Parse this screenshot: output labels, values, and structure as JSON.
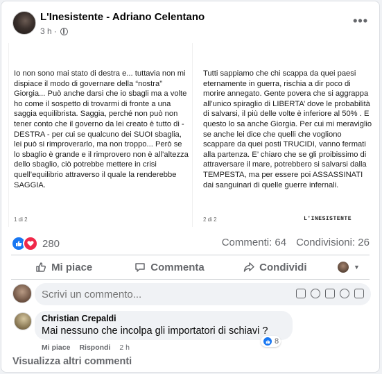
{
  "post": {
    "author": "L'Inesistente - Adriano Celentano",
    "time": "3 h",
    "privacy_icon": "globe-icon",
    "more_label": "•••"
  },
  "images": [
    {
      "text": "Io non sono mai stato di destra e... tuttavia non mi dispiace il modo di governare della “nostra” Giorgia... Può anche darsi che io sbagli ma a volte ho come il sospetto di trovarmi di fronte a una saggia equilibrista. Saggia, perché non può non tener conto che il governo da lei creato è tutto di - DESTRA - per cui se qualcuno dei SUOI sbaglia, lei può si rimproverarlo, ma non troppo... Però se lo sbaglio è grande e il rimprovero non è all’altezza dello sbaglio, ciò potrebbe mettere in crisi quell’equilibrio attraverso il quale la renderebbe SAGGIA.",
      "page": "1 di 2"
    },
    {
      "text": "Tutti sappiamo che chi scappa da quei paesi eternamente in guerra, rischia a dir poco di morire annegato. Gente povera che si aggrappa all’unico spiraglio di LIBERTA’ dove le probabilità di salvarsi, il più delle volte è inferiore al 50% . E questo lo sa anche Giorgia. Per cui mi meraviglio se anche lei dice che quelli che vogliono scappare da quei posti TRUCIDI, vanno fermati alla partenza. E’ chiaro che se gli proibissimo di attraversare il mare, potrebbero si salvarsi dalla TEMPESTA, ma per essere poi ASSASSINATI dai sanguinari di quelle guerre infernali.",
      "page": "2 di 2",
      "brand": "L'INESISTENTE"
    }
  ],
  "stats": {
    "reaction_count": "280",
    "comments": "Commenti: 64",
    "shares": "Condivisioni: 26"
  },
  "actions": {
    "like": "Mi piace",
    "comment": "Commenta",
    "share": "Condividi"
  },
  "composer": {
    "placeholder": "Scrivi un commento..."
  },
  "comment": {
    "author": "Christian Crepaldi",
    "text": "Mai nessuno che incolpa gli importatori di schiavi ?",
    "like_label": "Mi piace",
    "reply_label": "Rispondi",
    "time": "2 h",
    "reaction_count": "8"
  },
  "more_comments": "Visualizza altri commenti",
  "colors": {
    "like_blue": "#1877f2",
    "love_red": "#f02849",
    "secondary_text": "#65676b"
  }
}
